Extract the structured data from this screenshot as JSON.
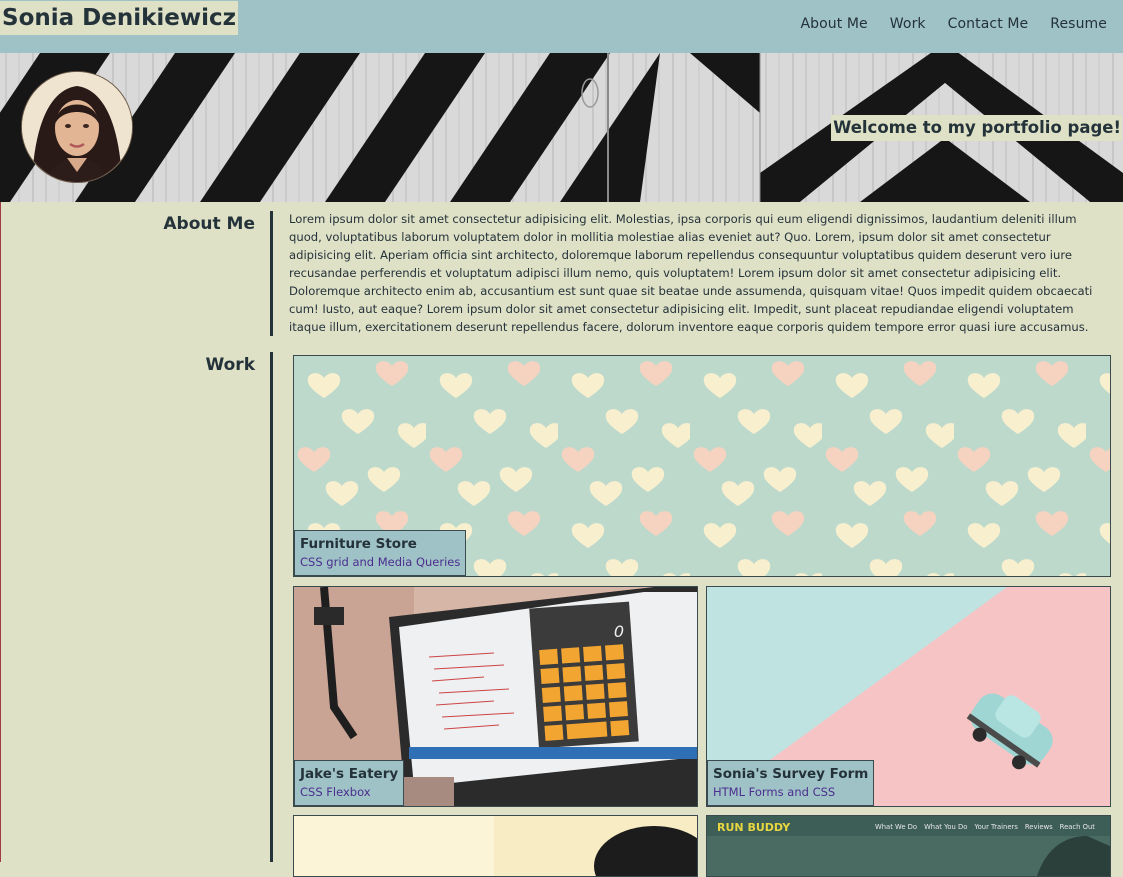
{
  "header": {
    "brand": "Sonia Denikiewicz",
    "nav": [
      "About Me",
      "Work",
      "Contact Me",
      "Resume"
    ]
  },
  "hero": {
    "welcome": "Welcome to my portfolio page!",
    "avatar_alt": "Profile photo"
  },
  "about": {
    "heading": "About Me",
    "text": "Lorem ipsum dolor sit amet consectetur adipisicing elit. Molestias, ipsa corporis qui eum eligendi dignissimos, laudantium deleniti illum quod, voluptatibus laborum voluptatem dolor in mollitia molestiae alias eveniet aut? Quo. Lorem, ipsum dolor sit amet consectetur adipisicing elit. Aperiam officia sint architecto, doloremque laborum repellendus consequuntur voluptatibus quidem deserunt vero iure recusandae perferendis et voluptatum adipisci illum nemo, quis voluptatem! Lorem ipsum dolor sit amet consectetur adipisicing elit. Doloremque architecto enim ab, accusantium est sunt quae sit beatae unde assumenda, quisquam vitae! Quos impedit quidem obcaecati cum! Iusto, aut eaque? Lorem ipsum dolor sit amet consectetur adipisicing elit. Impedit, sunt placeat repudiandae eligendi voluptatem itaque illum, exercitationem deserunt repellendus facere, dolorum inventore eaque corporis quidem tempore error quasi iure accusamus."
  },
  "work": {
    "heading": "Work",
    "projects": [
      {
        "title": "Furniture Store",
        "subtitle": "CSS grid and Media Queries"
      },
      {
        "title": "Jake's Eatery",
        "subtitle": "CSS Flexbox"
      },
      {
        "title": "Sonia's Survey Form",
        "subtitle": "HTML Forms and CSS"
      }
    ],
    "calculator_display": "0",
    "run_buddy": {
      "logo": "RUN BUDDY",
      "nav": [
        "What We Do",
        "What You Do",
        "Your Trainers",
        "Reviews",
        "Reach Out"
      ]
    }
  },
  "colors": {
    "background": "#dfe1c7",
    "header": "#9fc2c6",
    "text": "#24323a",
    "link": "#4b2e8f"
  }
}
